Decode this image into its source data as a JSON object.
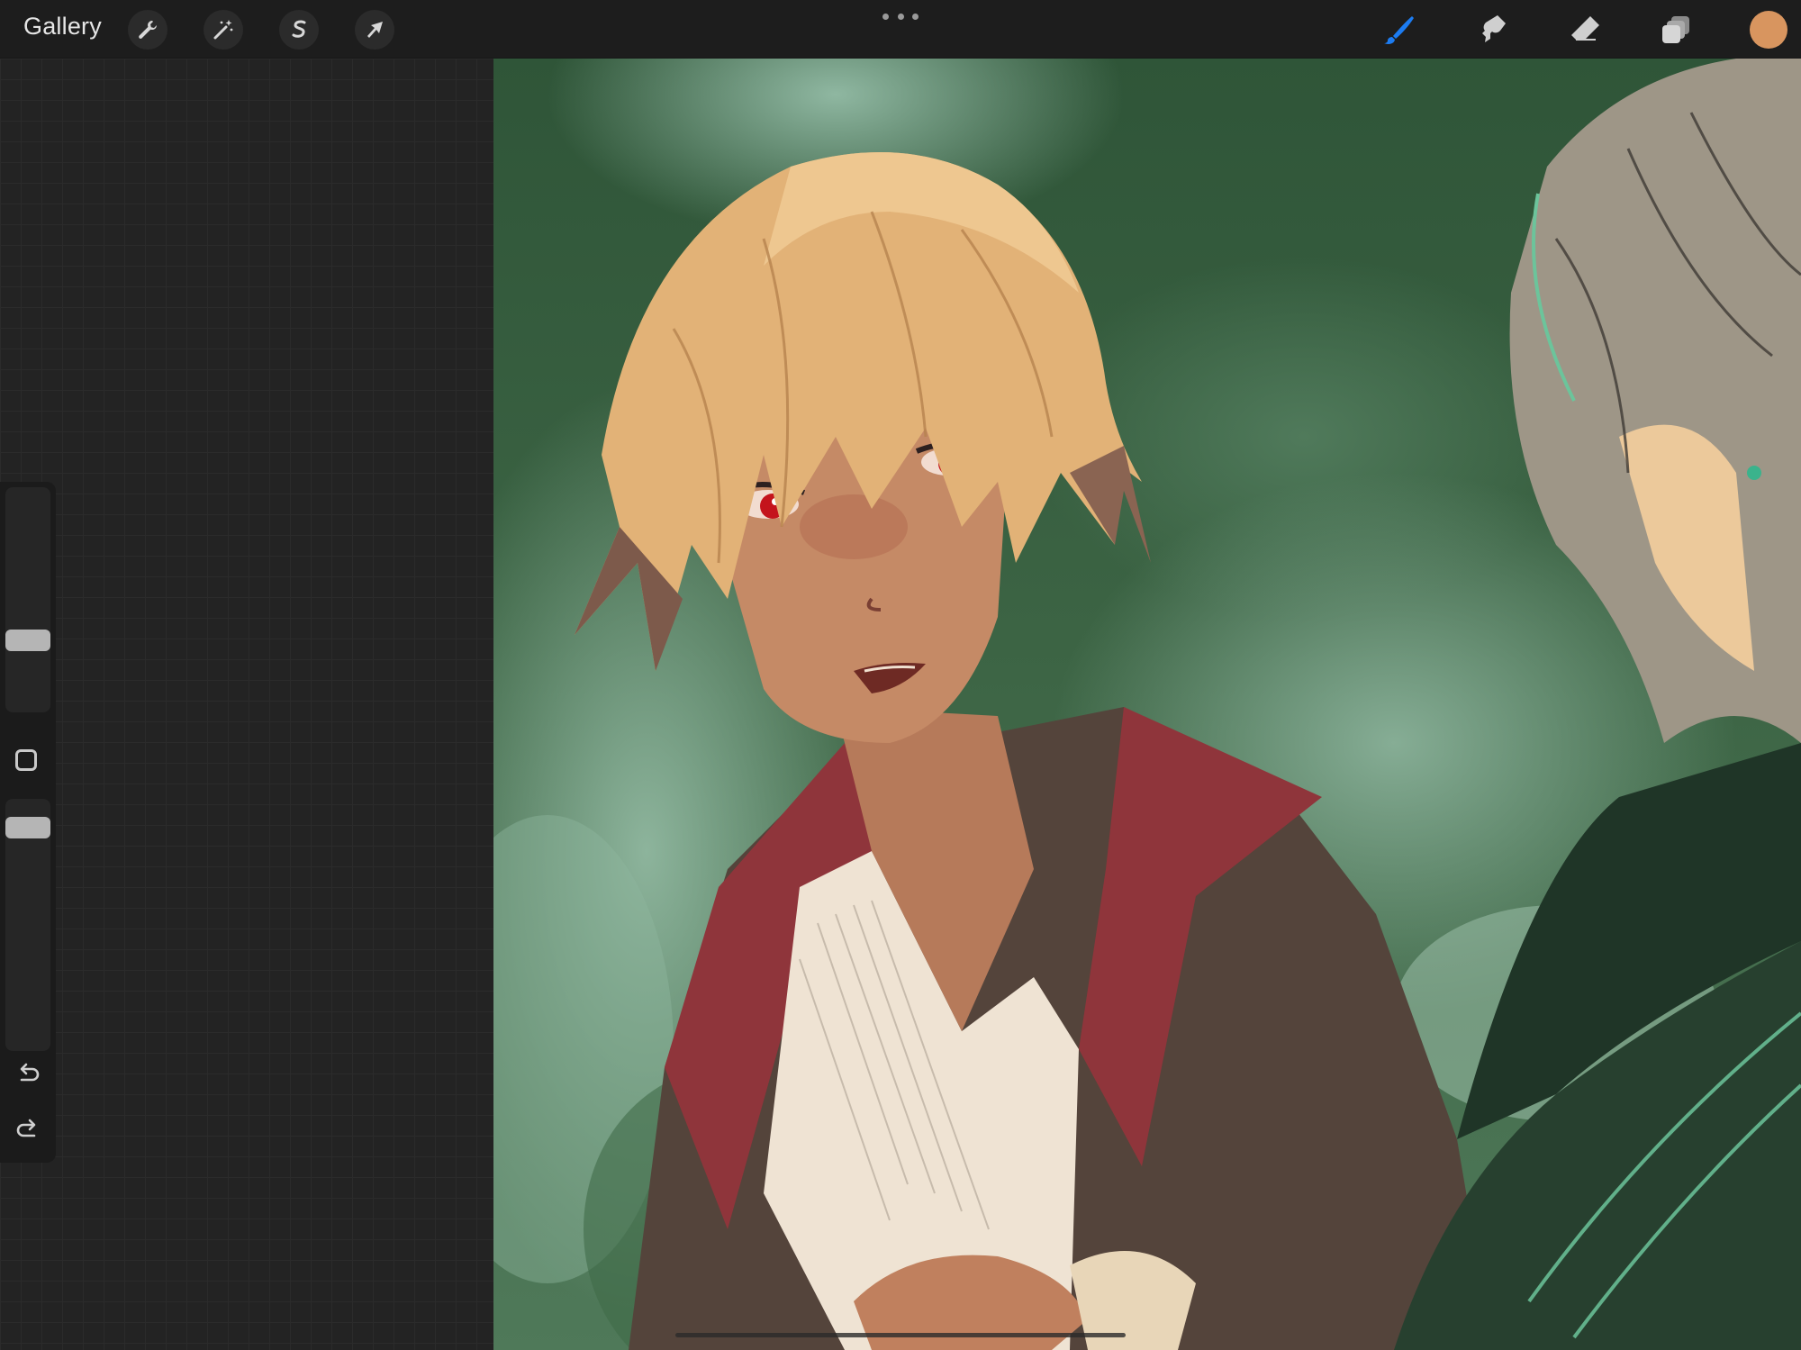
{
  "toolbar": {
    "gallery_label": "Gallery",
    "left_tools": [
      {
        "name": "actions",
        "icon": "wrench-icon"
      },
      {
        "name": "adjustments",
        "icon": "magic-wand-icon"
      },
      {
        "name": "selection",
        "icon": "selection-s-icon"
      },
      {
        "name": "transform",
        "icon": "arrow-cursor-icon"
      }
    ],
    "more_menu_icon": "ellipsis-icon",
    "right_tools": [
      {
        "name": "brush",
        "icon": "brush-icon",
        "active": true
      },
      {
        "name": "smudge",
        "icon": "smudge-icon",
        "active": false
      },
      {
        "name": "eraser",
        "icon": "eraser-icon",
        "active": false
      },
      {
        "name": "layers",
        "icon": "layers-icon",
        "active": false
      }
    ],
    "current_color": "#D8955F"
  },
  "sidebar": {
    "brush_size_level": 0.3,
    "opacity_level": 0.92,
    "modify_button_icon": "square-icon",
    "undo_icon": "undo-icon",
    "redo_icon": "redo-icon"
  },
  "colors": {
    "accent": "#1C7CF2",
    "toolbar_bg": "#1D1D1D",
    "panel_bg": "#232323",
    "canvas_green": "#3C6444"
  },
  "canvas": {
    "content": "anime-style-illustration"
  }
}
